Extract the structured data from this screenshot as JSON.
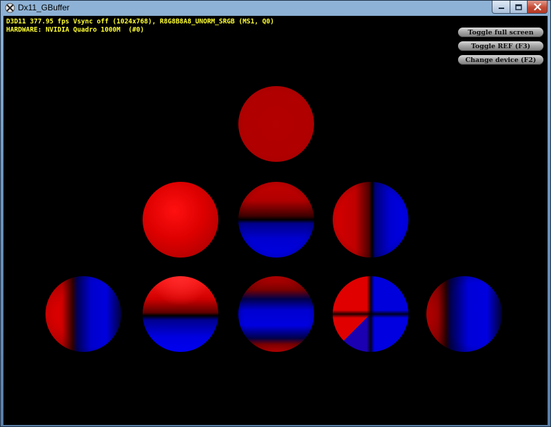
{
  "window": {
    "title": "Dx11_GBuffer"
  },
  "hud": {
    "line1": "D3D11 377.95 fps Vsync off (1024x768), R8G8B8A8_UNORM_SRGB (MS1, Q0)",
    "line2": "HARDWARE: NVIDIA Quadro 1000M  (#0)"
  },
  "buttons": {
    "toggle_full_screen": "Toggle full screen",
    "toggle_ref": "Toggle REF (F3)",
    "change_device": "Change device (F2)"
  },
  "colors": {
    "hud_text": "#ffff33",
    "sphere_red": "#ff0000",
    "sphere_blue": "#0000ff",
    "background": "#000000"
  },
  "icons": {
    "app": "directx-app-icon",
    "minimize": "minimize-icon",
    "maximize": "maximize-icon",
    "close": "close-icon"
  }
}
